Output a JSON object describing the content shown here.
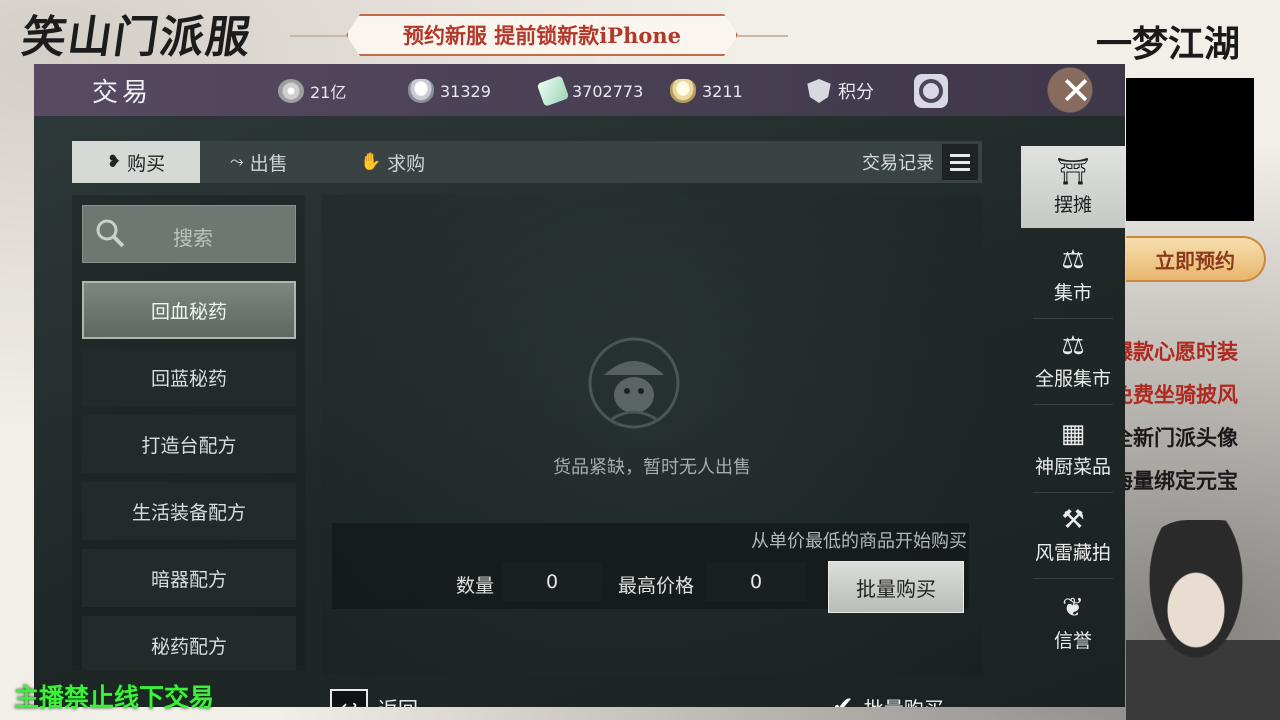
{
  "overlay": {
    "logo_left": "笑山门派服",
    "banner": "预约新服 提前锁新款iPhone",
    "logo_right": "一梦江湖",
    "reserve_button": "立即预约",
    "promo_items": [
      "爆款心愿时装",
      "免费坐骑披风",
      "全新门派头像",
      "海量绑定元宝"
    ],
    "streamer_note": "主播禁止线下交易"
  },
  "game": {
    "title": "交易",
    "currencies": [
      {
        "icon": "coin-icon",
        "value": "21亿"
      },
      {
        "icon": "silver-ingot-icon",
        "value": "31329"
      },
      {
        "icon": "jade-icon",
        "value": "3702773"
      },
      {
        "icon": "gold-ingot-icon",
        "value": "3211"
      },
      {
        "icon": "shield-icon",
        "value": "积分"
      }
    ],
    "tabs": [
      {
        "label": "购买",
        "icon": "buy-icon",
        "active": true
      },
      {
        "label": "出售",
        "icon": "sell-icon",
        "active": false
      },
      {
        "label": "求购",
        "icon": "request-icon",
        "active": false
      }
    ],
    "trade_record": "交易记录",
    "search_placeholder": "搜索",
    "categories": [
      {
        "label": "回血秘药",
        "active": true
      },
      {
        "label": "回蓝秘药",
        "active": false
      },
      {
        "label": "打造台配方",
        "active": false
      },
      {
        "label": "生活装备配方",
        "active": false
      },
      {
        "label": "暗器配方",
        "active": false
      },
      {
        "label": "秘药配方",
        "active": false
      }
    ],
    "empty_text": "货品紧缺，暂时无人出售",
    "buy_hint": "从单价最低的商品开始购买",
    "quantity_label": "数量",
    "quantity_value": "0",
    "max_price_label": "最高价格",
    "max_price_value": "0",
    "batch_buy_button": "批量购买",
    "back_label": "返回",
    "batch_buy_toggle": "批量购买",
    "side_nav": [
      {
        "label": "摆摊",
        "icon": "stall-icon",
        "active": true
      },
      {
        "label": "集市",
        "icon": "scale-icon",
        "active": false
      },
      {
        "label": "全服集市",
        "icon": "scale-icon",
        "active": false
      },
      {
        "label": "神厨菜品",
        "icon": "shop-icon",
        "active": false
      },
      {
        "label": "风雷藏拍",
        "icon": "auction-hammer-icon",
        "active": false
      },
      {
        "label": "信誉",
        "icon": "reputation-icon",
        "active": false
      }
    ]
  },
  "colors": {
    "topbar": "#574a63",
    "panel": "#1f2827",
    "promo_red": "#b0291f",
    "streamer_green": "#3cf03c"
  }
}
